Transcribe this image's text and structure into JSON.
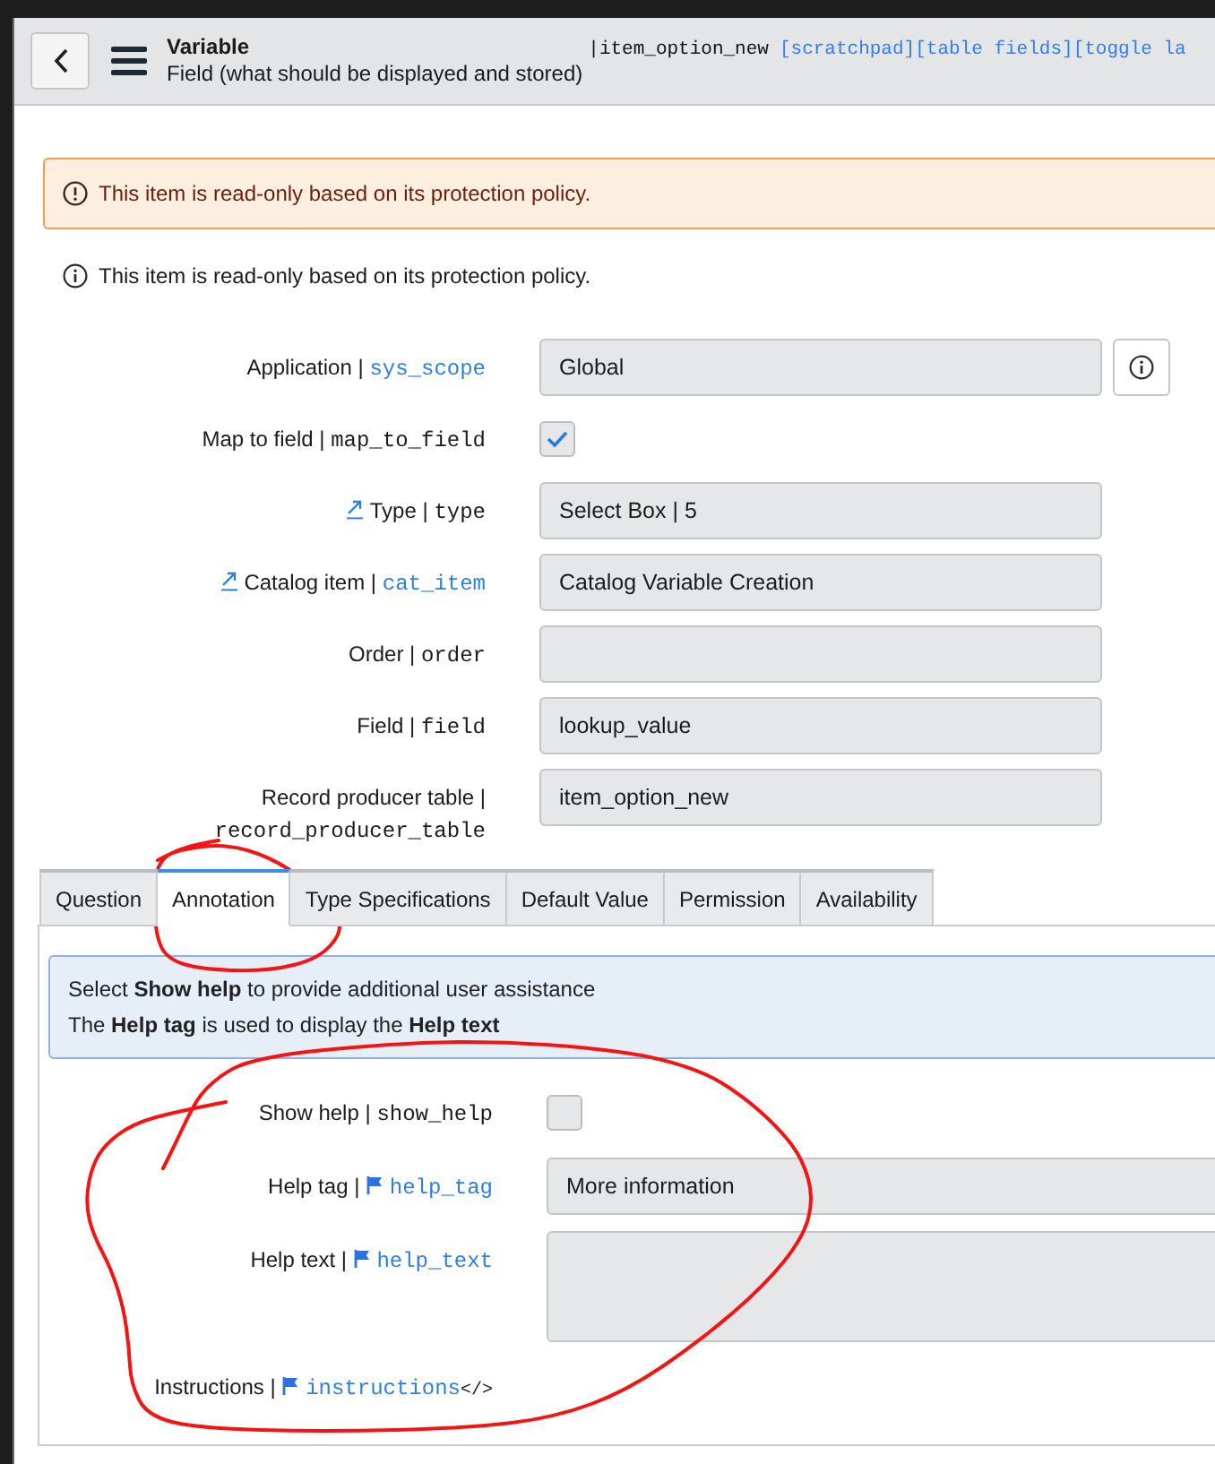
{
  "header": {
    "title": "Variable",
    "subtitle": "Field (what should be displayed and stored)",
    "table_name": "|item_option_new",
    "links": [
      "[scratchpad]",
      "[table fields]",
      "[toggle la"
    ]
  },
  "banner": {
    "kind": "warning",
    "text": "This item is read-only based on its protection policy."
  },
  "notice": {
    "text": "This item is read-only based on its protection policy."
  },
  "fields": [
    {
      "label": "Application |",
      "column": "sys_scope",
      "column_link": true,
      "reference_link": false,
      "kind": "text",
      "value": "Global",
      "info_button": true
    },
    {
      "label": "Map to field |",
      "column": "map_to_field",
      "column_link": false,
      "reference_link": false,
      "kind": "checkbox",
      "checked": true,
      "info_button": false
    },
    {
      "label": "Type |",
      "column": "type",
      "column_link": false,
      "reference_link": true,
      "kind": "text",
      "value": "Select Box | 5",
      "info_button": false
    },
    {
      "label": "Catalog item |",
      "column": "cat_item",
      "column_link": true,
      "reference_link": true,
      "kind": "text",
      "value": "Catalog Variable Creation",
      "info_button": false
    },
    {
      "label": "Order |",
      "column": "order",
      "column_link": false,
      "reference_link": false,
      "kind": "text",
      "info_button": false
    },
    {
      "label": "Field |",
      "column": "field",
      "column_link": false,
      "reference_link": false,
      "kind": "text",
      "value": "lookup_value",
      "info_button": false
    },
    {
      "label": "Record producer table |",
      "column": "record_producer_table",
      "column_link": false,
      "reference_link": false,
      "kind": "text",
      "value": "item_option_new",
      "info_button": false
    }
  ],
  "tabs": [
    {
      "label": "Question",
      "selected": false
    },
    {
      "label": "Annotation",
      "selected": true
    },
    {
      "label": "Type Specifications",
      "selected": false
    },
    {
      "label": "Default Value",
      "selected": false
    },
    {
      "label": "Permission",
      "selected": false
    },
    {
      "label": "Availability",
      "selected": false
    }
  ],
  "tab_panel": {
    "info_lines": [
      "Select **Show help** to provide additional user assistance",
      "The **Help tag** is used to display the **Help text**"
    ],
    "fields": [
      {
        "label": "Show help |",
        "column": "show_help",
        "column_link": false,
        "flag": false,
        "kind": "checkbox",
        "checked": false
      },
      {
        "label": "Help tag |",
        "column": "help_tag",
        "column_link": true,
        "flag": true,
        "kind": "text",
        "value": "More information"
      },
      {
        "label": "Help text |",
        "column": "help_text",
        "column_link": true,
        "flag": true,
        "kind": "textarea"
      },
      {
        "label": "Instructions |",
        "column": "instructions",
        "column_link": true,
        "flag": true,
        "kind": "label",
        "suffix": "</>"
      }
    ]
  }
}
